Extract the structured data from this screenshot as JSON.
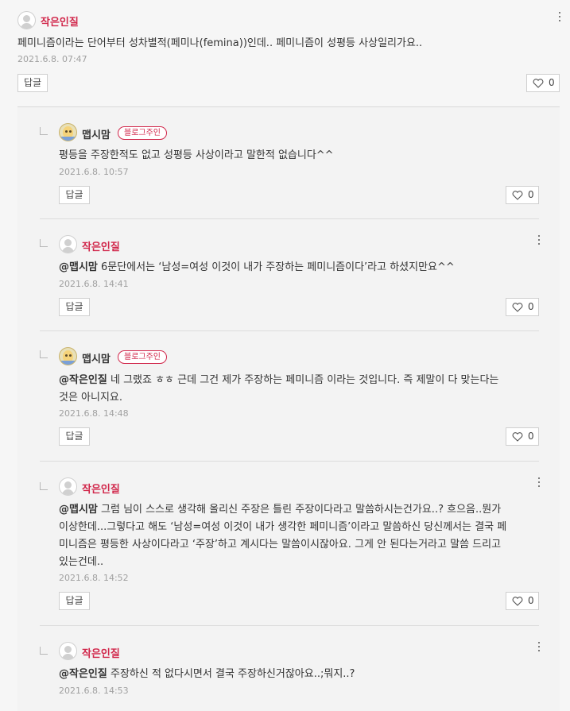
{
  "top_comment": {
    "author": "작은인질",
    "text": "페미니즘이라는 단어부터 성차별적(페미나(femina))인데.. 페미니즘이 성평등 사상일리가요..",
    "date": "2021.6.8. 07:47",
    "reply_label": "답글",
    "likes": "0"
  },
  "replies": [
    {
      "author": "맵시맘",
      "badge": "블로그주인",
      "mention": "",
      "text": "평등을 주장한적도 없고 성평등 사상이라고 말한적 없습니다^^",
      "date": "2021.6.8. 10:57",
      "reply_label": "답글",
      "likes": "0"
    },
    {
      "author": "작은인질",
      "mention": "@맵시맘",
      "text": "6문단에서는 ‘남성=여성 이것이 내가 주장하는 페미니즘이다’라고 하셨지만요^^",
      "date": "2021.6.8. 14:41",
      "reply_label": "답글",
      "likes": "0"
    },
    {
      "author": "맵시맘",
      "badge": "블로그주인",
      "mention": "@작은인질",
      "text_line1": "네 그랬죠 ㅎㅎ 근데 그건 제가 주장하는 페미니즘 이라는 것입니다. 즉 제말이 다 맞는다는",
      "text_line2": "것은 아니지요.",
      "date": "2021.6.8. 14:48",
      "reply_label": "답글",
      "likes": "0"
    },
    {
      "author": "작은인질",
      "mention": "@맵시맘",
      "text_line1": "그럼 님이 스스로 생각해 올리신 주장은 틀린 주장이다라고 말씀하시는건가요..? 흐으음..뭔가",
      "text_line2": "이상한데...그렇다고 해도 ‘남성=여성 이것이 내가 생각한 페미니즘’이라고 말씀하신 당신께서는 결국 페",
      "text_line3": "미니즘은 평등한 사상이다라고 ‘주장’하고 계시다는 말씀이시잖아요. 그게 안 된다는거라고 말씀 드리고",
      "text_line4": "있는건데..",
      "date": "2021.6.8. 14:52",
      "reply_label": "답글",
      "likes": "0"
    },
    {
      "author": "작은인질",
      "mention": "@작은인질",
      "text": "주장하신 적 없다시면서 결국 주장하신거잖아요..;뭐지..?",
      "date": "2021.6.8. 14:53"
    }
  ]
}
